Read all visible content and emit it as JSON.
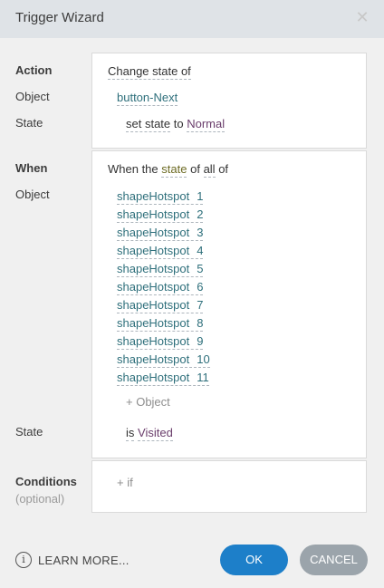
{
  "dialog": {
    "title": "Trigger Wizard",
    "close_icon": "close-icon"
  },
  "action": {
    "section_label": "Action",
    "object_label": "Object",
    "state_label": "State",
    "verb": "Change state of",
    "object_value": "button-Next",
    "state_prefix": "set state",
    "state_to": "to",
    "state_value": "Normal"
  },
  "when": {
    "section_label": "When",
    "object_label": "Object",
    "state_label": "State",
    "condition_prefix": "When the",
    "condition_state": "state",
    "condition_of": "of",
    "condition_all": "all",
    "condition_suffix": "of",
    "objects": [
      {
        "name": "shapeHotspot",
        "num": "1"
      },
      {
        "name": "shapeHotspot",
        "num": "2"
      },
      {
        "name": "shapeHotspot",
        "num": "3"
      },
      {
        "name": "shapeHotspot",
        "num": "4"
      },
      {
        "name": "shapeHotspot",
        "num": "5"
      },
      {
        "name": "shapeHotspot",
        "num": "6"
      },
      {
        "name": "shapeHotspot",
        "num": "7"
      },
      {
        "name": "shapeHotspot",
        "num": "8"
      },
      {
        "name": "shapeHotspot",
        "num": "9"
      },
      {
        "name": "shapeHotspot",
        "num": "10"
      },
      {
        "name": "shapeHotspot",
        "num": "11"
      }
    ],
    "add_object": "+ Object",
    "state_is": "is",
    "state_value": "Visited"
  },
  "conditions": {
    "section_label": "Conditions",
    "optional_label": "(optional)",
    "add_if": "+ if"
  },
  "footer": {
    "info_icon": "info-icon",
    "learn_more": "LEARN MORE...",
    "ok_label": "OK",
    "cancel_label": "CANCEL"
  }
}
